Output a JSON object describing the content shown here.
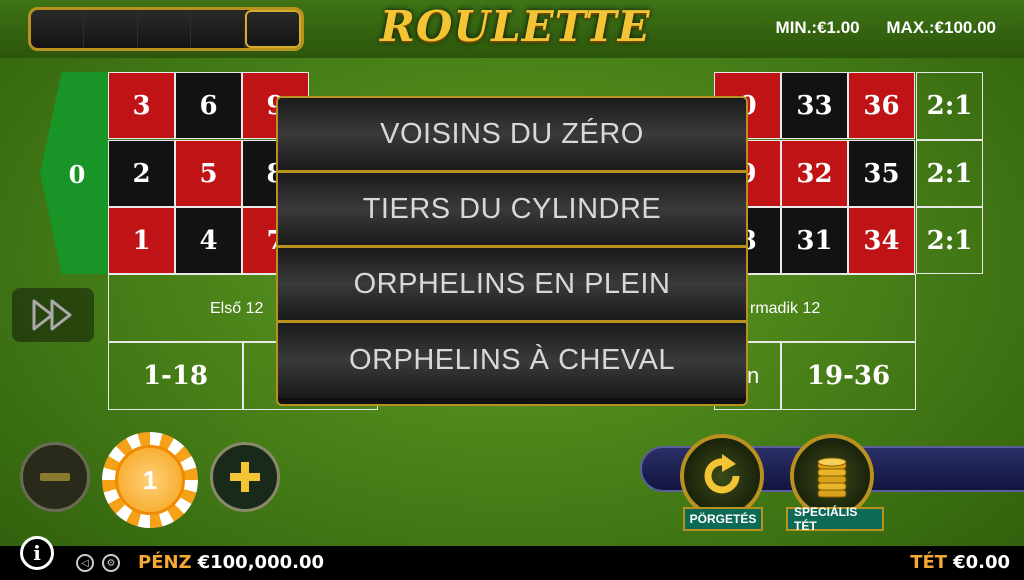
{
  "header": {
    "title": "ROULETTE",
    "min_label": "MIN.:",
    "min_value": "€1.00",
    "max_label": "MAX.:",
    "max_value": "€100.00"
  },
  "table": {
    "zero": "0",
    "cells": [
      {
        "n": "3",
        "color": "red"
      },
      {
        "n": "6",
        "color": "black"
      },
      {
        "n": "9",
        "color": "red"
      },
      {
        "n": "2",
        "color": "black"
      },
      {
        "n": "5",
        "color": "red"
      },
      {
        "n": "8",
        "color": "black"
      },
      {
        "n": "1",
        "color": "red"
      },
      {
        "n": "4",
        "color": "black"
      },
      {
        "n": "7",
        "color": "red"
      },
      {
        "n": "0",
        "color": "red"
      },
      {
        "n": "33",
        "color": "black"
      },
      {
        "n": "36",
        "color": "red"
      },
      {
        "n": "9",
        "color": "red"
      },
      {
        "n": "32",
        "color": "red"
      },
      {
        "n": "35",
        "color": "black"
      },
      {
        "n": "8",
        "color": "black"
      },
      {
        "n": "31",
        "color": "black"
      },
      {
        "n": "34",
        "color": "red"
      }
    ],
    "column_bets": [
      "2:1",
      "2:1",
      "2:1"
    ],
    "dozen_first": "Első 12",
    "dozen_third": "rmadik 12",
    "low": "1-18",
    "high": "19-36",
    "partial_n": "n"
  },
  "modal": {
    "options": [
      "VOISINS DU ZÉRO",
      "TIERS DU CYLINDRE",
      "ORPHELINS EN PLEIN",
      "ORPHELINS À CHEVAL"
    ]
  },
  "controls": {
    "chip_value": "1",
    "spin_label": "PÖRGETÉS",
    "special_label": "SPECIÁLIS TÉT"
  },
  "footer": {
    "balance_label": "PÉNZ",
    "balance_value": "€100,000.00",
    "bet_label": "TÉT",
    "bet_value": "€0.00"
  },
  "colors": {
    "red": "#c01315",
    "black": "#121212",
    "gold": "#b8911f",
    "felt": "#4a8219"
  }
}
